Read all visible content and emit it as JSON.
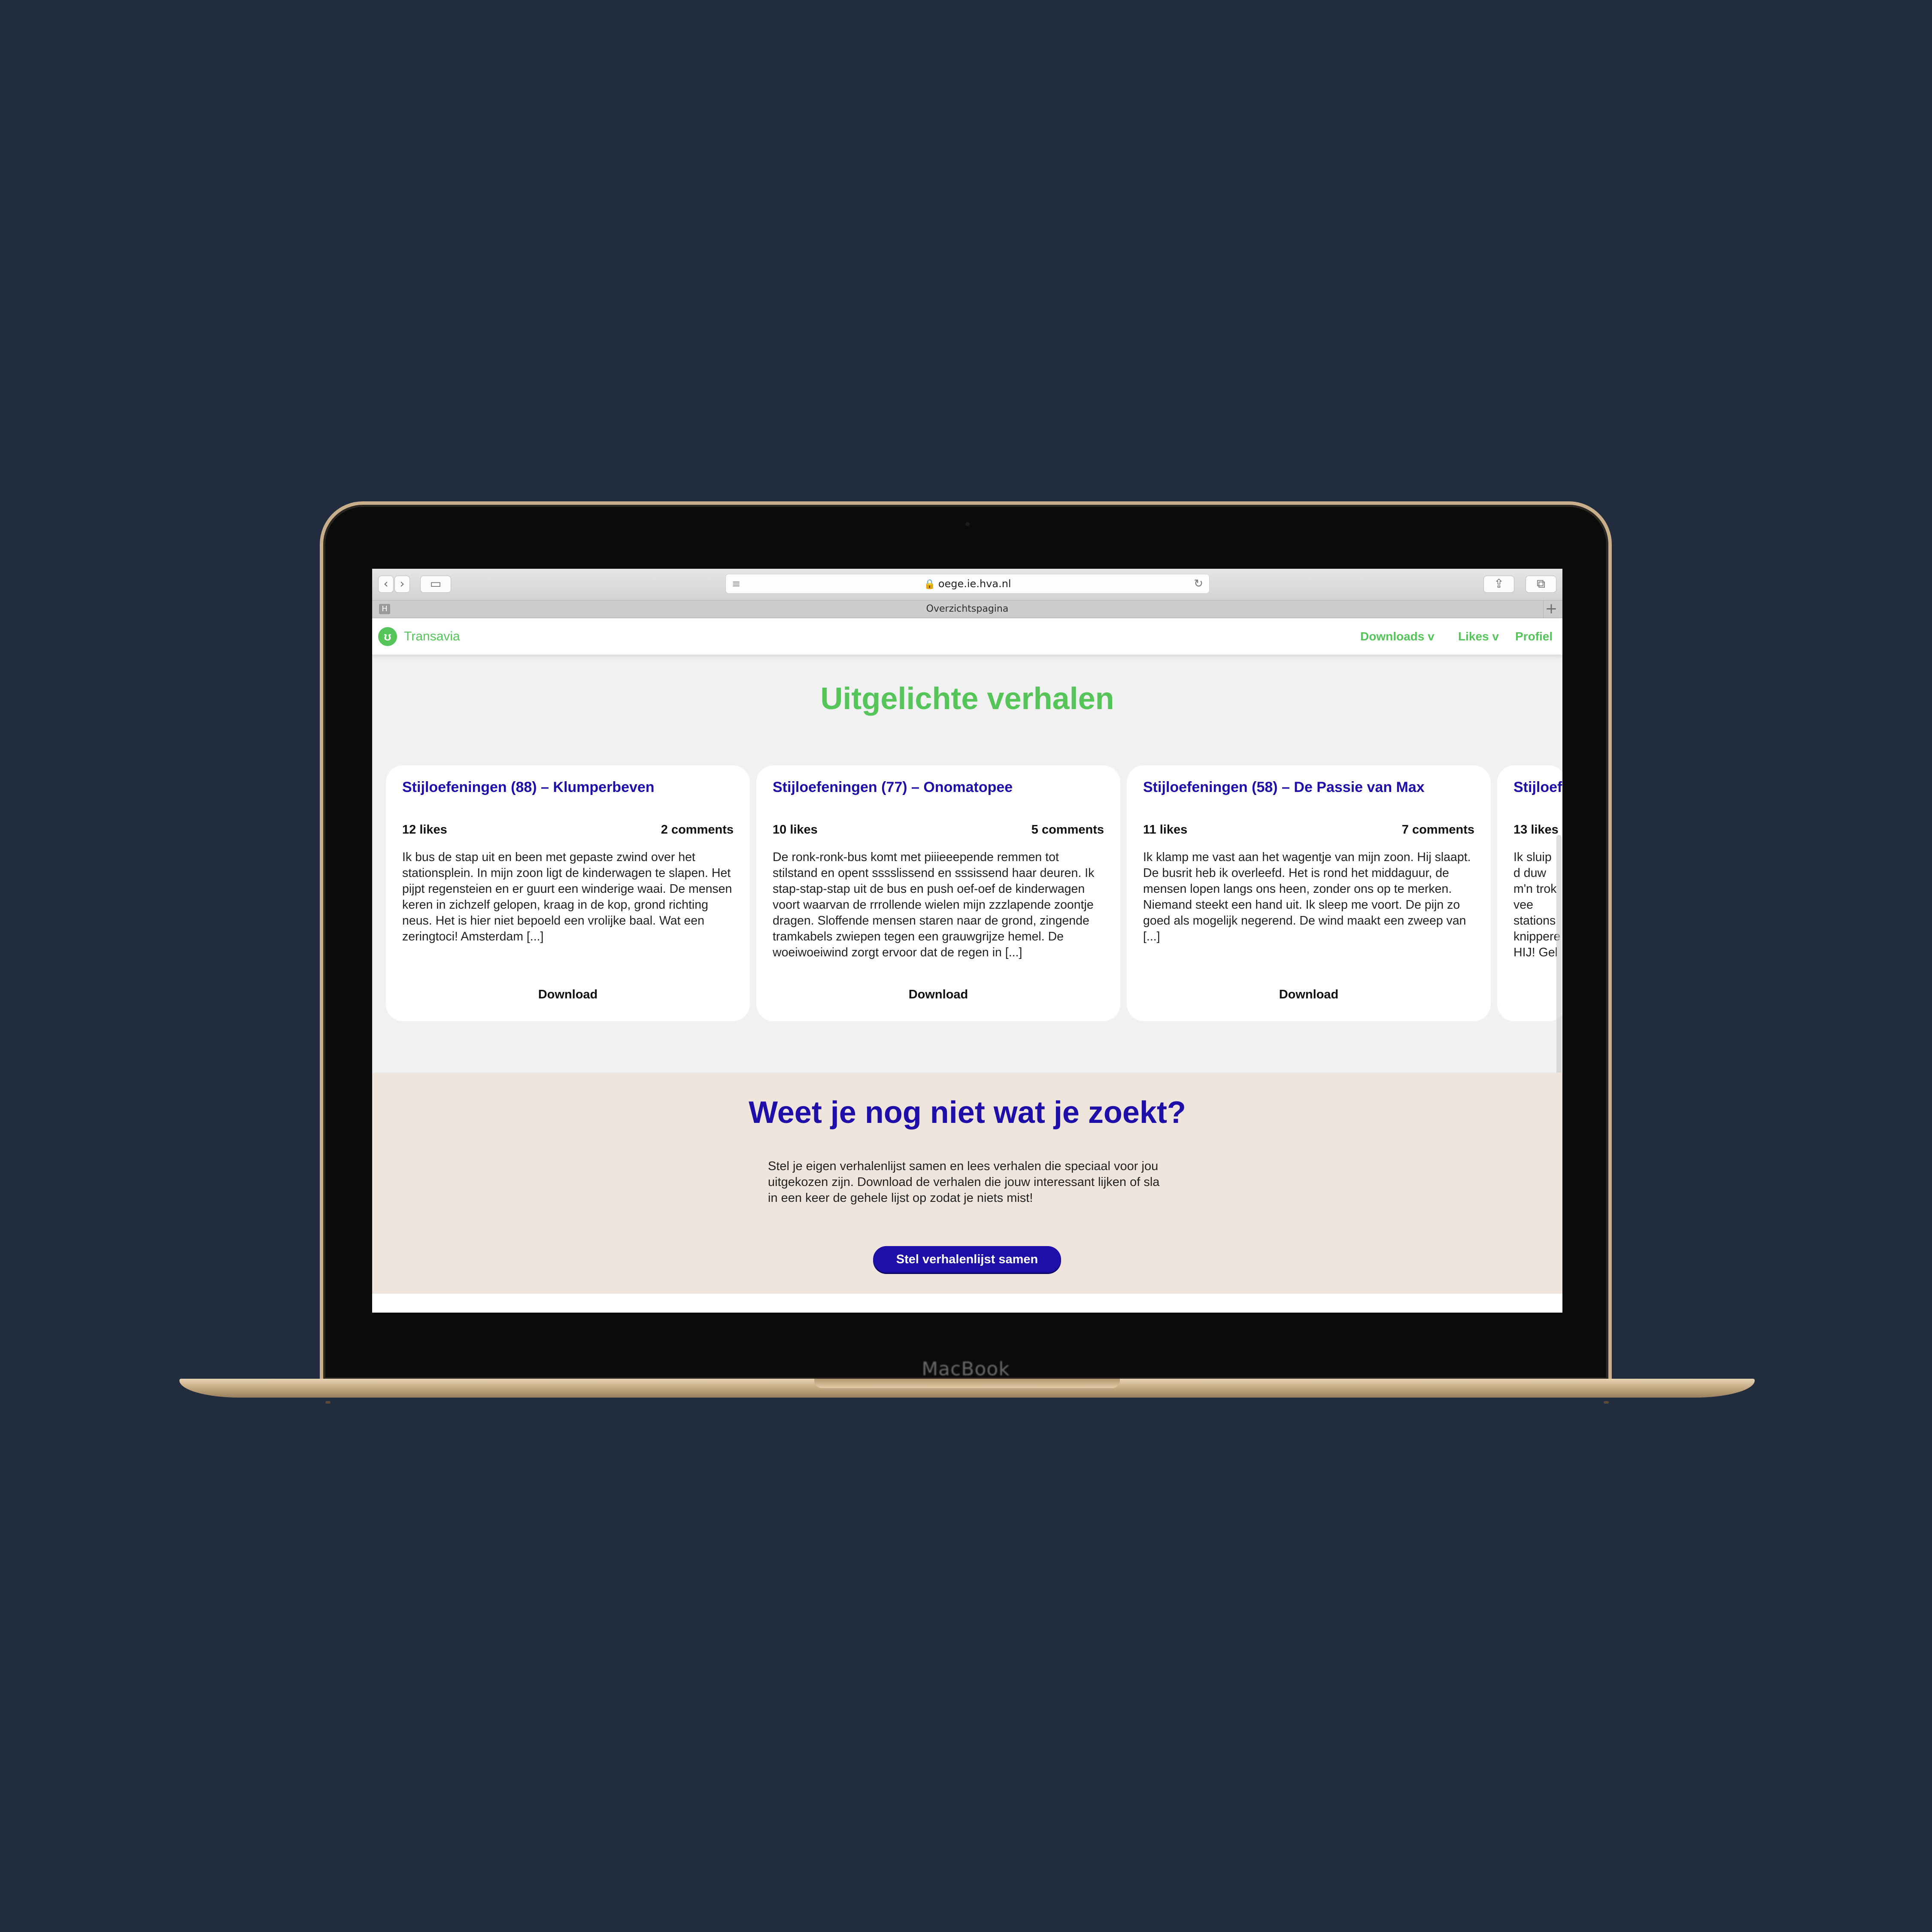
{
  "device": {
    "label": "MacBook"
  },
  "browser": {
    "url": "oege.ie.hva.nl",
    "tab_title": "Overzichtspagina",
    "tab_badge": "H",
    "new_tab": "+"
  },
  "site": {
    "brand": "Transavia",
    "nav": [
      "Downloads v",
      "Likes v",
      "Profiel"
    ]
  },
  "featured": {
    "title": "Uitgelichte verhalen",
    "download_label": "Download",
    "cards": [
      {
        "title": "Stijloefeningen (88) – Klumperbeven",
        "likes": "12 likes",
        "comments": "2 comments",
        "text": "Ik bus de stap uit en been met gepaste zwind over het stationsplein. In mijn zoon ligt de kinderwagen te slapen. Het pijpt regensteien en er guurt een winderige waai. De mensen keren in zichzelf gelopen, kraag in de kop, grond richting neus. Het is hier niet bepoeld een vrolijke baal. Wat een zeringtoci! Amsterdam [...]"
      },
      {
        "title": "Stijloefeningen (77) – Onomatopee",
        "likes": "10 likes",
        "comments": "5 comments",
        "text": "De ronk-ronk-bus komt met piiieeepende remmen tot stilstand en opent sssslissend en sssissend haar deuren. Ik stap-stap-stap uit de bus en push oef-oef de kinderwagen voort waarvan de rrrollende wielen mijn zzzlapende zoontje dragen. Sloffende mensen staren naar de grond, zingende tramkabels zwiepen tegen een grauwgrijze hemel. De woeiwoeiwind zorgt ervoor dat de regen in [...]"
      },
      {
        "title": "Stijloefeningen (58) – De Passie van Max",
        "likes": "11 likes",
        "comments": "7 comments",
        "text": "Ik klamp me vast aan het wagentje van mijn zoon. Hij slaapt. De busrit heb ik overleefd. Het is rond het middaguur, de mensen lopen langs ons heen, zonder ons op te merken. Niemand steekt een hand uit. Ik sleep me voort. De pijn zo goed als mogelijk negerend. De wind maakt een zweep van [...]"
      },
      {
        "title": "Stijloef",
        "likes": "13 likes",
        "comments": "",
        "text": "Ik sluip d duw m'n trok vee stations knippere HIJ! Gel"
      }
    ]
  },
  "search_help": {
    "title": "Weet je nog niet wat je zoekt?",
    "text": "Stel je eigen verhalenlijst samen en lees verhalen die speciaal voor jou uitgekozen zijn. Download de verhalen die jouw interessant lijken of sla in een keer de gehele lijst op zodat je niets mist!",
    "button": "Stel verhalenlijst samen"
  },
  "colors": {
    "background": "#212d3f",
    "brand_green": "#55c55a",
    "accent_blue": "#1d0fa8",
    "section_beige": "#efe5dc"
  }
}
